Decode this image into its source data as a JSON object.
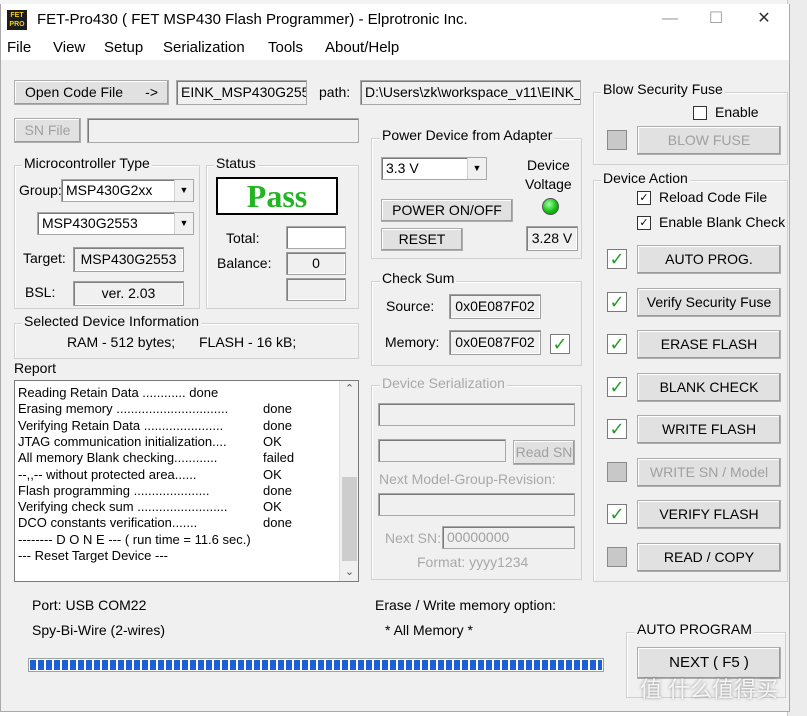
{
  "window": {
    "title": "FET-Pro430  ( FET MSP430 Flash Programmer)  -  Elprotronic Inc.",
    "icon_text": "FET\nPRO",
    "controls": [
      "minimize-icon",
      "maximize-icon",
      "close-icon"
    ]
  },
  "menu": [
    "File",
    "View",
    "Setup",
    "Serialization",
    "Tools",
    "About/Help"
  ],
  "code_file": {
    "open_button": "Open Code File",
    "open_arrow": "->",
    "file_name": "EINK_MSP430G255",
    "path_label": "path:",
    "path_value": "D:\\Users\\zk\\workspace_v11\\EINK_",
    "sn_file_button": "SN File",
    "sn_file_value": ""
  },
  "microcontroller": {
    "title": "Microcontroller Type",
    "group_label": "Group:",
    "group_value": "MSP430G2xx",
    "device_value": "MSP430G2553",
    "target_label": "Target:",
    "target_value": "MSP430G2553",
    "bsl_label": "BSL:",
    "bsl_value": "ver.  2.03"
  },
  "status": {
    "title": "Status",
    "result": "Pass",
    "total_label": "Total:",
    "total_value": "",
    "balance_label": "Balance:",
    "balance_value": "0",
    "extra_value": ""
  },
  "device_info": {
    "title": "Selected Device Information",
    "ram": "RAM -    512 bytes;",
    "flash": "FLASH - 16 kB;"
  },
  "power": {
    "title": "Power Device from Adapter",
    "voltage_select": "3.3 V",
    "device_voltage_label": "Device\nVoltage",
    "power_button": "POWER ON/OFF",
    "reset_button": "RESET",
    "voltage_reading": "3.28 V",
    "led_color": "#13c013"
  },
  "checksum": {
    "title": "Check Sum",
    "source_label": "Source:",
    "source_value": "0x0E087F02",
    "memory_label": "Memory:",
    "memory_value": "0x0E087F02",
    "match_icon": "checkmark-icon"
  },
  "serialization": {
    "title": "Device Serialization",
    "field1": "",
    "field2": "",
    "read_sn_button": "Read SN",
    "model_label": "Next Model-Group-Revision:",
    "model_value": "",
    "next_sn_label": "Next SN:",
    "next_sn_value": "00000000",
    "format_label": "Format: yyyy1234"
  },
  "report": {
    "title": "Report",
    "lines": [
      {
        "text": "Reading Retain Data ............  done",
        "status": ""
      },
      {
        "text": "Erasing memory ...............................",
        "status": "done"
      },
      {
        "text": "Verifying Retain Data ......................",
        "status": "done"
      },
      {
        "text": "JTAG communication initialization....",
        "status": "OK"
      },
      {
        "text": "All memory Blank checking............",
        "status": "failed"
      },
      {
        "text": "  --,,-- without protected area......",
        "status": "OK"
      },
      {
        "text": "Flash programming .....................",
        "status": "done"
      },
      {
        "text": "Verifying check sum .........................",
        "status": "OK"
      },
      {
        "text": "DCO constants verification.......",
        "status": "done"
      },
      {
        "text": " -------- D O N E --- ( run time = 11.6 sec.)",
        "status": ""
      },
      {
        "text": " --- Reset Target Device ---",
        "status": ""
      }
    ]
  },
  "blow_fuse": {
    "title": "Blow Security Fuse",
    "enable_label": "Enable",
    "button": "BLOW FUSE"
  },
  "device_action": {
    "title": "Device Action",
    "reload_label": "Reload Code File",
    "blank_check_label": "Enable Blank Check",
    "actions": [
      {
        "label": "AUTO PROG.",
        "checked": true,
        "enabled": true
      },
      {
        "label": "Verify Security Fuse",
        "checked": true,
        "enabled": true
      },
      {
        "label": "ERASE FLASH",
        "checked": true,
        "enabled": true
      },
      {
        "label": "BLANK CHECK",
        "checked": true,
        "enabled": true
      },
      {
        "label": "WRITE FLASH",
        "checked": true,
        "enabled": true
      },
      {
        "label": "WRITE SN / Model",
        "checked": false,
        "enabled": false
      },
      {
        "label": "VERIFY FLASH",
        "checked": true,
        "enabled": true
      },
      {
        "label": "READ / COPY",
        "checked": false,
        "enabled": true
      }
    ]
  },
  "footer": {
    "port": "Port: USB COM22",
    "interface": "Spy-Bi-Wire (2-wires)",
    "erase_option_label": "Erase / Write memory option:",
    "erase_option_value": "* All Memory *",
    "progress_percent": 100
  },
  "auto_program": {
    "title": "AUTO PROGRAM",
    "next_button": "NEXT  ( F5 )"
  },
  "watermark": "值 什么值得买"
}
